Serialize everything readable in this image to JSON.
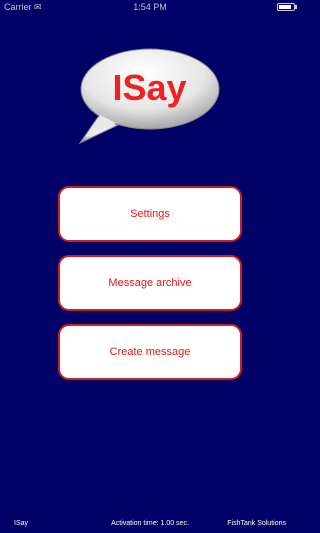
{
  "status_bar": {
    "carrier": "Carrier ✉",
    "time": "1:54 PM"
  },
  "logo": {
    "text": "ISay"
  },
  "menu": {
    "settings_label": "Settings",
    "archive_label": "Message archive",
    "create_label": "Create message"
  },
  "footer": {
    "app_name": "ISay",
    "activation_time": "Activation time: 1.00 sec.",
    "company": "FishTank Solutions"
  },
  "colors": {
    "background": "#000066",
    "accent": "#dd1a1a",
    "button_bg": "#ffffff"
  }
}
